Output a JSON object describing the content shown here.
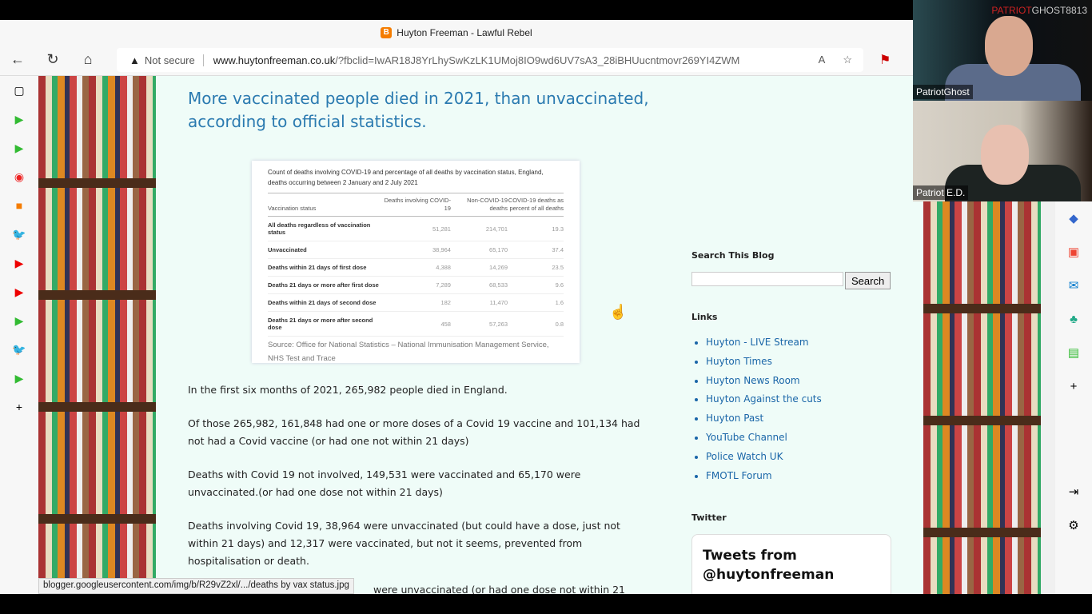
{
  "browser": {
    "tab_title": "Huyton Freeman - Lawful Rebel",
    "security": "Not secure",
    "url_host": "www.huytonfreeman.co.uk",
    "url_query": "/?fbclid=IwAR18J8YrLhySwKzLK1UMoj8IO9wd6UV7sA3_28iBHUucntmovr269YI4ZWM",
    "status_url": "blogger.googleusercontent.com/img/b/R29vZ2xl/.../deaths by vax status.jpg"
  },
  "post": {
    "title": "More vaccinated people died in 2021, than unvaccinated, according to official statistics.",
    "paragraphs": [
      "In the first six months of 2021, 265,982 people died in England.",
      "Of those 265,982, 161,848 had one or more doses of a Covid 19 vaccine and 101,134 had not had a Covid vaccine (or had one not within 21 days)",
      "Deaths with Covid 19 not involved, 149,531 were vaccinated and 65,170 were unvaccinated.(or had one dose not within 21 days)",
      "Deaths involving Covid 19, 38,964 were unvaccinated (but could have a dose, just not within 21 days) and 12,317 were vaccinated, but not it seems, prevented from hospitalisation or death.",
      "were unvaccinated (or had one dose not within 21"
    ]
  },
  "table": {
    "caption": "Count of deaths involving COVID-19 and percentage of all deaths by vaccination status, England, deaths occurring between 2 January and 2 July 2021",
    "headers": [
      "Vaccination status",
      "Deaths involving COVID-19",
      "Non-COVID-19 deaths",
      "COVID-19 deaths as percent of all deaths"
    ],
    "rows": [
      [
        "All deaths regardless of vaccination status",
        "51,281",
        "214,701",
        "19.3"
      ],
      [
        "Unvaccinated",
        "38,964",
        "65,170",
        "37.4"
      ],
      [
        "Deaths within 21 days of first dose",
        "4,388",
        "14,269",
        "23.5"
      ],
      [
        "Deaths 21 days or more after first dose",
        "7,289",
        "68,533",
        "9.6"
      ],
      [
        "Deaths within 21 days of second dose",
        "182",
        "11,470",
        "1.6"
      ],
      [
        "Deaths 21 days or more after second dose",
        "458",
        "57,263",
        "0.8"
      ]
    ],
    "source": "Source: Office for National Statistics – National Immunisation Management Service, NHS Test and Trace"
  },
  "sidebar": {
    "search_title": "Search This Blog",
    "search_button": "Search",
    "links_title": "Links",
    "links": [
      "Huyton - LIVE Stream",
      "Huyton Times",
      "Huyton News Room",
      "Huyton Against the cuts",
      "Huyton Past",
      "YouTube Channel",
      "Police Watch UK",
      "FMOTL Forum"
    ],
    "twitter_title": "Twitter",
    "tweets_header": "Tweets from @huytonfreeman"
  },
  "video": {
    "participant1": "PatriotGhost",
    "participant2": "Patriot E.D.",
    "brand_red": "PATRIOT",
    "brand_white": "GHOST8813"
  },
  "colors": {
    "accent": "#2a7ab0",
    "link": "#1a66a8",
    "page_bg": "#effcf8"
  }
}
